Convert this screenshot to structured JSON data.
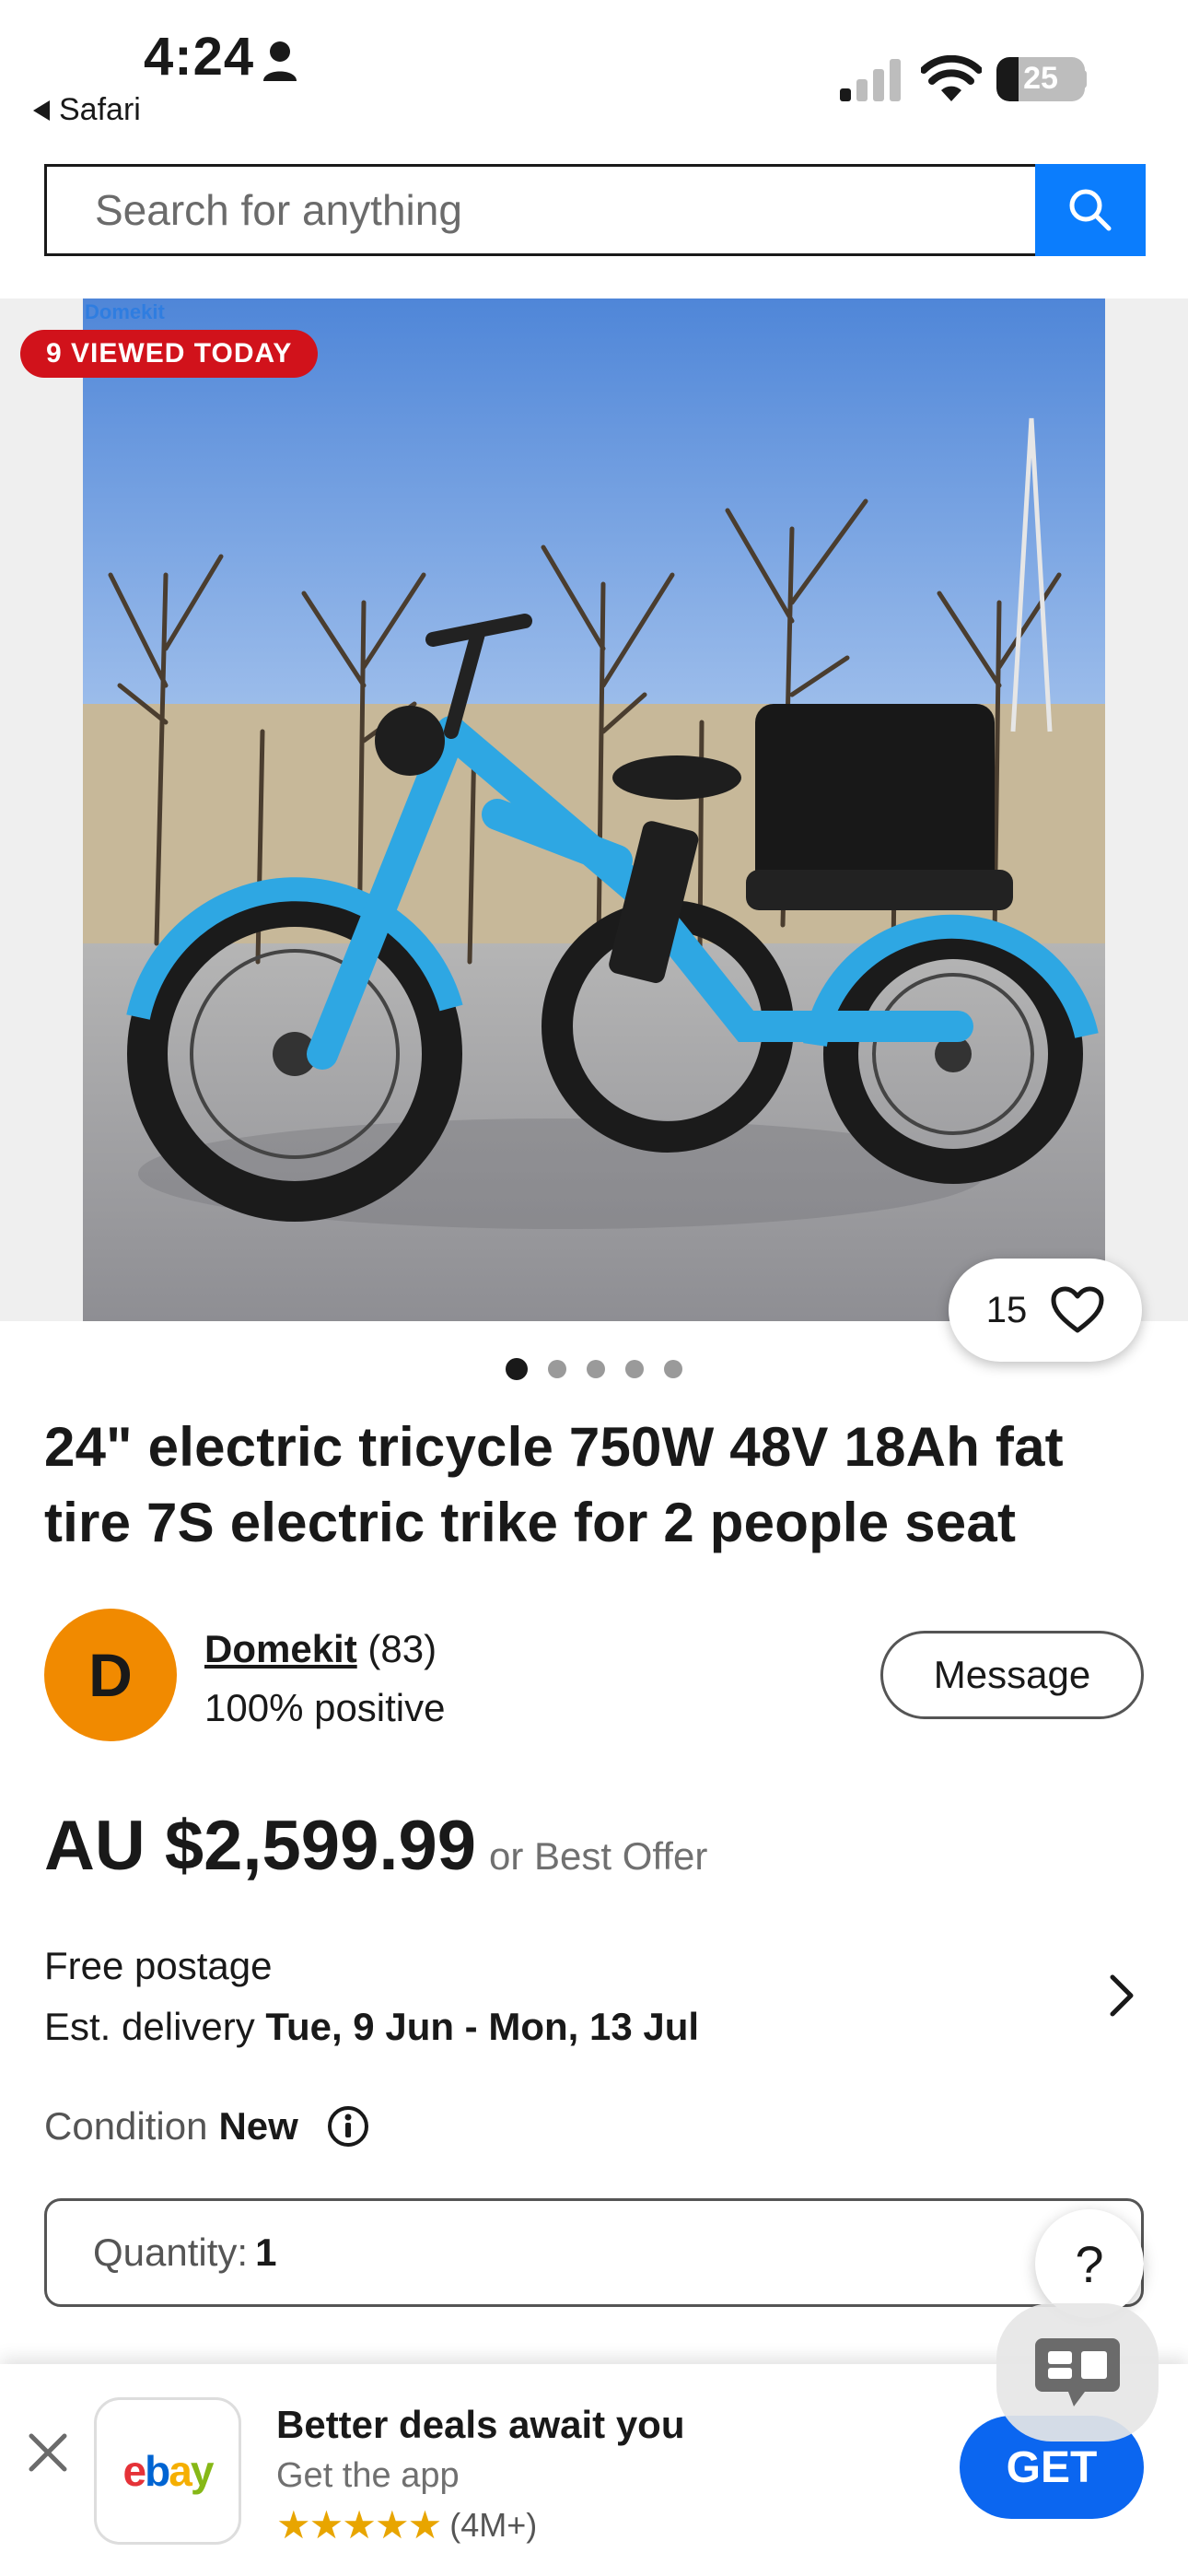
{
  "status_bar": {
    "time": "4:24",
    "back_app": "Safari",
    "battery_level": 25,
    "battery_text": "25"
  },
  "search": {
    "placeholder": "Search for anything"
  },
  "hero": {
    "watermark": "Domekit",
    "badge": "9 VIEWED TODAY",
    "watch_count": "15",
    "image_count": 5,
    "active_image": 1
  },
  "listing": {
    "title": "24\" electric tricycle 750W 48V 18Ah fat tire 7S electric trike for 2 people seat",
    "seller": {
      "initial": "D",
      "name": "Domekit",
      "feedback": "(83)",
      "positive": "100% positive"
    },
    "message_label": "Message",
    "price": "AU $2,599.99",
    "best_offer": "or Best Offer",
    "postage": "Free postage",
    "delivery_label": "Est. delivery",
    "delivery_dates": "Tue, 9 Jun - Mon, 13 Jul",
    "condition_label": "Condition",
    "condition_value": "New",
    "quantity_label": "Quantity:",
    "quantity_value": "1",
    "help_label": "?"
  },
  "app_banner": {
    "logo_letters": [
      "e",
      "b",
      "a",
      "y"
    ],
    "logo_colors": [
      "#e53238",
      "#0064d2",
      "#f5af02",
      "#86b817"
    ],
    "title": "Better deals await you",
    "subtitle": "Get the app",
    "stars": "★★★★★",
    "rating_count": "(4M+)",
    "get_label": "GET"
  },
  "colors": {
    "accent": "#0b7dfd",
    "badge_red": "#d1121b",
    "avatar": "#f18a00",
    "get_button": "#0b66f0"
  }
}
